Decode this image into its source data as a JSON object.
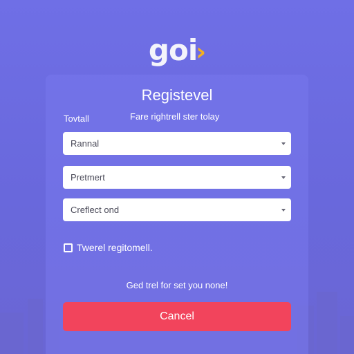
{
  "logo": {
    "text": "goi",
    "chevron": "›"
  },
  "form": {
    "title": "Registevel",
    "toggle_label": "Tovtall",
    "subtitle": "Fare rightrell ster tolay",
    "fields": [
      {
        "value": "Rannal",
        "icon": "chevron-down-icon"
      },
      {
        "value": "Pretmert",
        "icon": "chevron-down-icon"
      },
      {
        "value": "Creflect ond",
        "icon": "chevron-down-icon"
      }
    ],
    "checkbox_label": "Twerel regitomell.",
    "help_text": "Ged trel for set you none!",
    "cancel_label": "Cancel"
  },
  "colors": {
    "background": "#6968dc",
    "accent": "#f4b021",
    "button": "#f2445c"
  }
}
